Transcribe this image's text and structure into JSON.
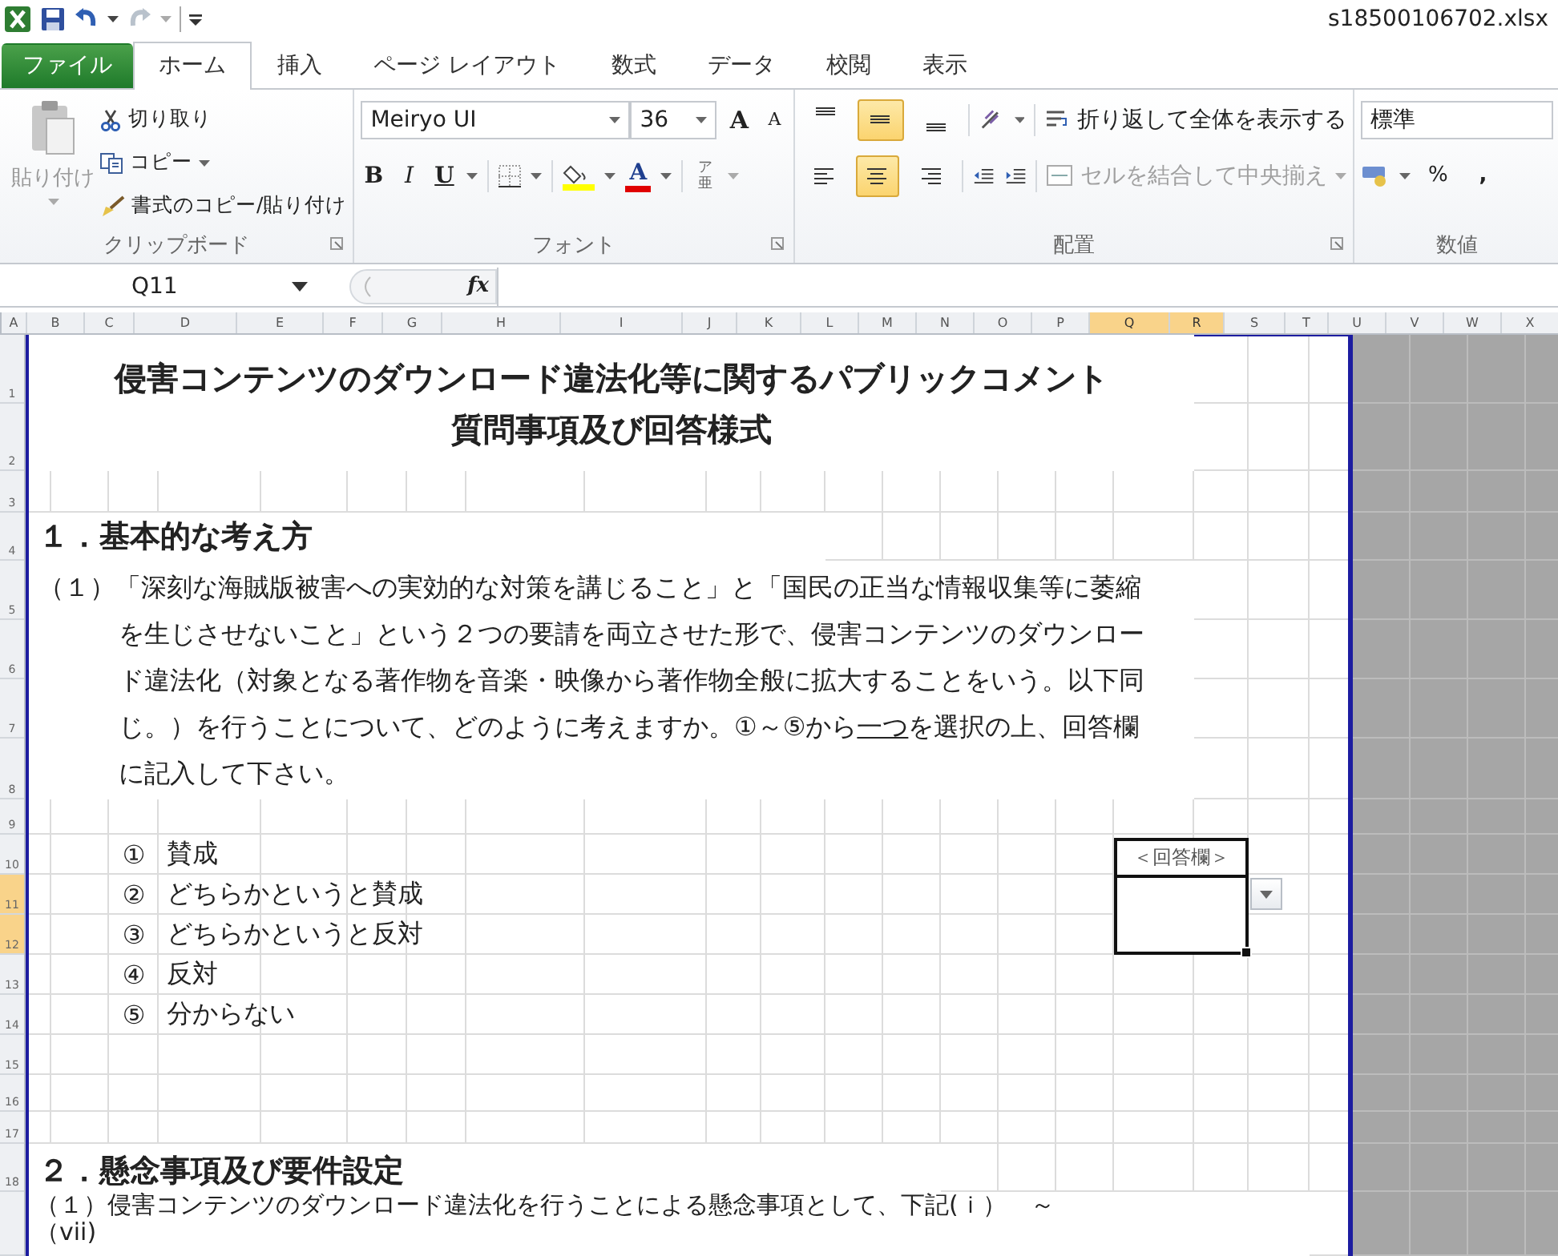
{
  "window": {
    "title": "s18500106702.xlsx"
  },
  "tabs": [
    {
      "label": "ファイル",
      "kind": "file",
      "selected": false
    },
    {
      "label": "ホーム",
      "kind": "tab",
      "selected": true
    },
    {
      "label": "挿入",
      "kind": "tab",
      "selected": false
    },
    {
      "label": "ページ レイアウト",
      "kind": "tab",
      "selected": false
    },
    {
      "label": "数式",
      "kind": "tab",
      "selected": false
    },
    {
      "label": "データ",
      "kind": "tab",
      "selected": false
    },
    {
      "label": "校閲",
      "kind": "tab",
      "selected": false
    },
    {
      "label": "表示",
      "kind": "tab",
      "selected": false
    }
  ],
  "clipboard": {
    "paste": {
      "label": "貼り付け",
      "disabled": true
    },
    "actions": [
      {
        "kind": "cut",
        "label": "切り取り",
        "dropdown": false
      },
      {
        "kind": "copy",
        "label": "コピー",
        "dropdown": true
      },
      {
        "kind": "format_painter",
        "label": "書式のコピー/貼り付け",
        "dropdown": false
      }
    ],
    "label": "クリップボード"
  },
  "font": {
    "name": "Meiryo UI",
    "size": "36",
    "grow": "A",
    "shrink": "A",
    "styles": [
      {
        "kind": "bold",
        "label": "B"
      },
      {
        "kind": "italic",
        "label": "I"
      },
      {
        "kind": "underline",
        "label": "U"
      }
    ],
    "font_color": "A",
    "phonetic_top": "ア",
    "phonetic_bottom": "亜",
    "label": "フォント"
  },
  "alignment": {
    "vertical": [
      {
        "kind": "top",
        "selected": false
      },
      {
        "kind": "middle",
        "selected": true
      },
      {
        "kind": "bottom",
        "selected": false
      }
    ],
    "horizontal": [
      {
        "kind": "left",
        "selected": false
      },
      {
        "kind": "center",
        "selected": true
      },
      {
        "kind": "right",
        "selected": false
      }
    ],
    "wrap": {
      "label": "折り返して全体を表示する",
      "disabled": false
    },
    "merge": {
      "label": "セルを結合して中央揃え",
      "disabled": true
    },
    "label": "配置"
  },
  "number": {
    "format": "標準",
    "percent": "%",
    "comma": ",",
    "label": "数値"
  },
  "formula_bar": {
    "name_box": "Q11",
    "fx": "fx"
  },
  "columns": [
    {
      "label": "A",
      "selected": false
    },
    {
      "label": "B",
      "selected": false
    },
    {
      "label": "C",
      "selected": false
    },
    {
      "label": "D",
      "selected": false
    },
    {
      "label": "E",
      "selected": false
    },
    {
      "label": "F",
      "selected": false
    },
    {
      "label": "G",
      "selected": false
    },
    {
      "label": "H",
      "selected": false
    },
    {
      "label": "I",
      "selected": false
    },
    {
      "label": "J",
      "selected": false
    },
    {
      "label": "K",
      "selected": false
    },
    {
      "label": "L",
      "selected": false
    },
    {
      "label": "M",
      "selected": false
    },
    {
      "label": "N",
      "selected": false
    },
    {
      "label": "O",
      "selected": false
    },
    {
      "label": "P",
      "selected": false
    },
    {
      "label": "Q",
      "selected": true
    },
    {
      "label": "R",
      "selected": true
    },
    {
      "label": "S",
      "selected": false
    },
    {
      "label": "T",
      "selected": false
    },
    {
      "label": "U",
      "selected": false
    },
    {
      "label": "V",
      "selected": false
    },
    {
      "label": "W",
      "selected": false
    },
    {
      "label": "X",
      "selected": false
    }
  ],
  "rows": [
    {
      "label": "1",
      "selected": false
    },
    {
      "label": "2",
      "selected": false
    },
    {
      "label": "3",
      "selected": false
    },
    {
      "label": "4",
      "selected": false
    },
    {
      "label": "5",
      "selected": false
    },
    {
      "label": "6",
      "selected": false
    },
    {
      "label": "7",
      "selected": false
    },
    {
      "label": "8",
      "selected": false
    },
    {
      "label": "9",
      "selected": false
    },
    {
      "label": "10",
      "selected": false
    },
    {
      "label": "11",
      "selected": true
    },
    {
      "label": "12",
      "selected": true
    },
    {
      "label": "13",
      "selected": false
    },
    {
      "label": "14",
      "selected": false
    },
    {
      "label": "15",
      "selected": false
    },
    {
      "label": "16",
      "selected": false
    },
    {
      "label": "17",
      "selected": false
    },
    {
      "label": "18",
      "selected": false
    }
  ],
  "sheet": {
    "title": [
      "侵害コンテンツのダウンロード違法化等に関するパブリックコメント",
      "質問事項及び回答様式"
    ],
    "section_1": "１．基本的な考え方",
    "question_1": [
      {
        "text": "（１）「深刻な海賊版被害への実効的な対策を講じること」と「国民の正当な情報収集等に萎縮を生じさせないこと」という２つの要請を両立させた形で、侵害コンテンツのダウンロード違法化（対象となる著作物を音楽・映像から著作物全般に拡大することをいう。以下同じ。）を行うことについて、どのように考えますか。①～⑤から",
        "underlined": false
      },
      {
        "text": "一つ",
        "underlined": true
      },
      {
        "text": "を選択の上、回答欄に記入して下さい。",
        "underlined": false
      }
    ],
    "options": [
      {
        "number": "①",
        "label": "賛成"
      },
      {
        "number": "②",
        "label": "どちらかというと賛成"
      },
      {
        "number": "③",
        "label": "どちらかというと反対"
      },
      {
        "number": "④",
        "label": "反対"
      },
      {
        "number": "⑤",
        "label": "分からない"
      }
    ],
    "answer_header": "＜回答欄＞",
    "section_2": "２．懸念事項及び要件設定",
    "question_2": [
      "（１）侵害コンテンツのダウンロード違法化を行うことによる懸念事項として、下記(ｉ）　～",
      "（vii)"
    ]
  }
}
